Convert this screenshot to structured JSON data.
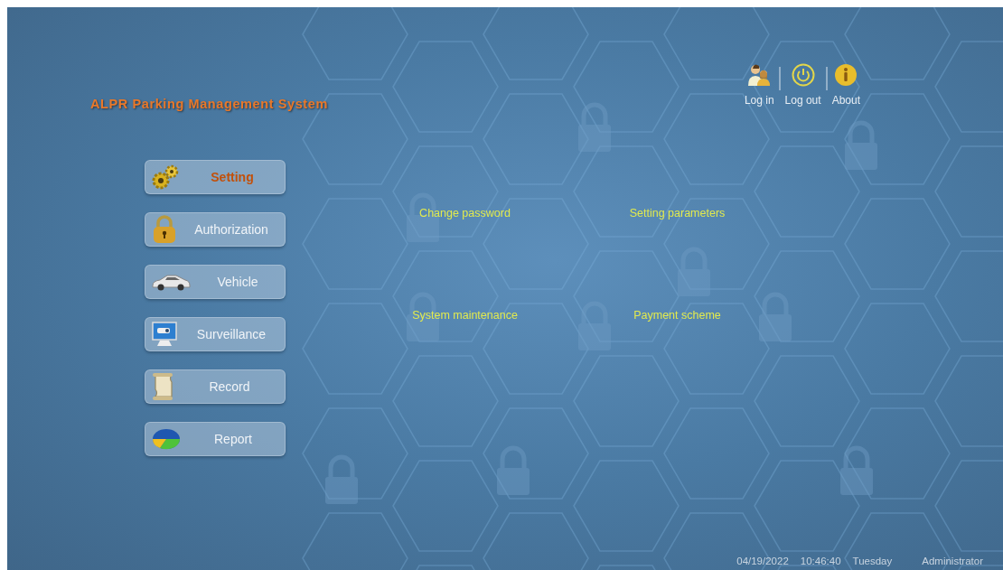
{
  "title": "ALPR Parking Management System",
  "header_actions": [
    {
      "label": "Log in",
      "kind": "login"
    },
    {
      "label": "Log out",
      "kind": "logout"
    },
    {
      "label": "About",
      "kind": "about"
    }
  ],
  "menu": [
    {
      "label": "Setting",
      "kind": "setting",
      "selected": true
    },
    {
      "label": "Authorization",
      "kind": "authorization",
      "selected": false
    },
    {
      "label": "Vehicle",
      "kind": "vehicle",
      "selected": false
    },
    {
      "label": "Surveillance",
      "kind": "surveillance",
      "selected": false
    },
    {
      "label": "Record",
      "kind": "record",
      "selected": false
    },
    {
      "label": "Report",
      "kind": "report",
      "selected": false
    }
  ],
  "submenu": [
    "Change password",
    "Setting parameters",
    "System maintenance",
    "Payment scheme"
  ],
  "status_bar": {
    "date": "04/19/2022",
    "time": "10:46:40",
    "weekday": "Tuesday",
    "user": "Administrator"
  }
}
